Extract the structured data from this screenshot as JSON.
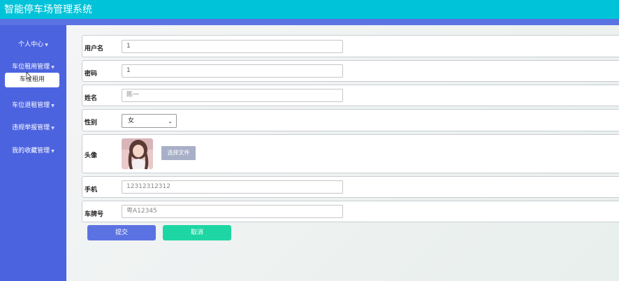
{
  "app": {
    "title": "智能停车场管理系统"
  },
  "sidebar": {
    "items": [
      {
        "label": "个人中心"
      },
      {
        "label": "车位租用管理"
      },
      {
        "label": "车位退租管理"
      },
      {
        "label": "违规举报管理"
      },
      {
        "label": "我的收藏管理"
      }
    ],
    "sub_item": {
      "label": "车位租用"
    }
  },
  "form": {
    "username": {
      "label": "用户名",
      "value": "1"
    },
    "password": {
      "label": "密码",
      "value": "1"
    },
    "name": {
      "label": "姓名",
      "value": "陈一"
    },
    "gender": {
      "label": "性别",
      "value": "女"
    },
    "avatar": {
      "label": "头像",
      "button": "选择文件"
    },
    "phone": {
      "label": "手机",
      "value": "12312312312"
    },
    "plate": {
      "label": "车牌号",
      "value": "粤A12345"
    }
  },
  "actions": {
    "submit": "提交",
    "cancel": "取消"
  },
  "colors": {
    "header": "#00c3d9",
    "sidebar": "#4c63e0",
    "primary": "#5b73e2",
    "success": "#1dd6a4"
  }
}
